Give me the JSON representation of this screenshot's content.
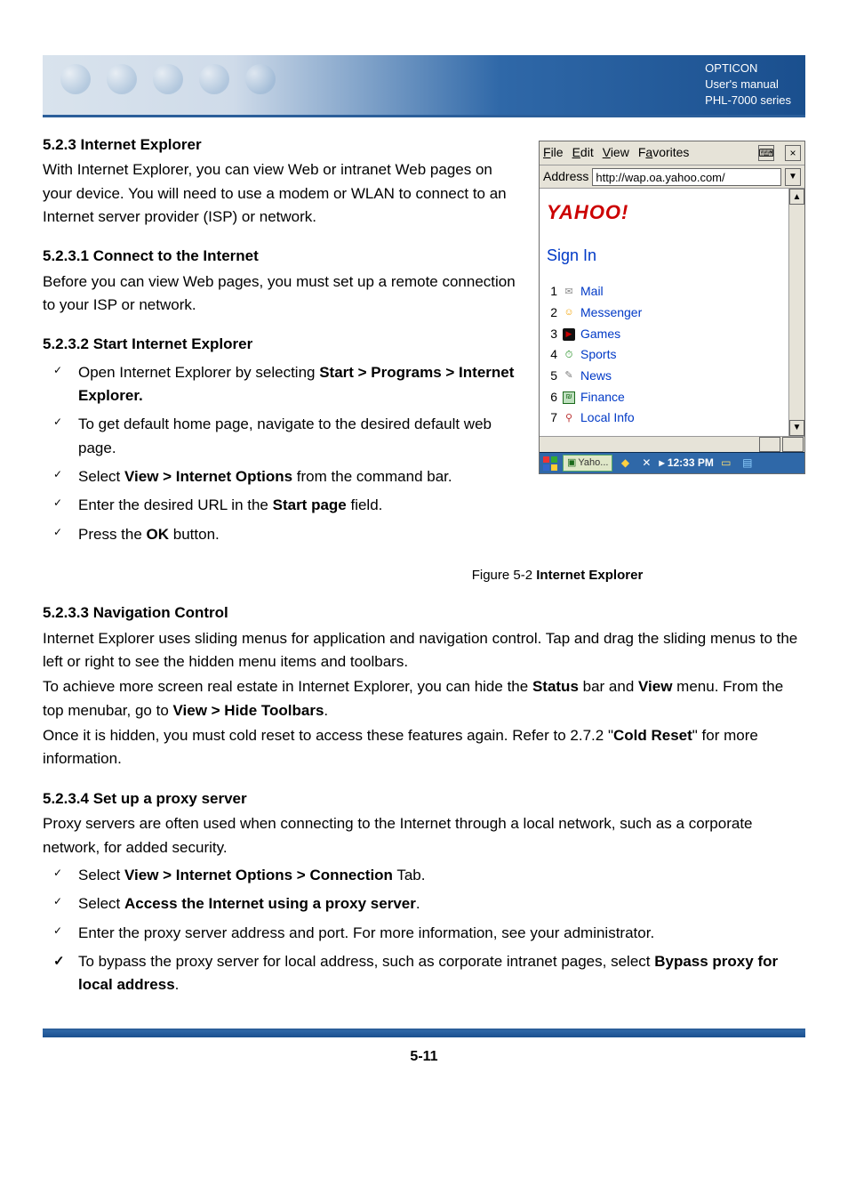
{
  "header": {
    "brand_line1": "OPTICON",
    "brand_line2": "User's manual",
    "brand_line3": "PHL-7000 series"
  },
  "sections": {
    "s523_title": "5.2.3 Internet Explorer",
    "s523_body": "With Internet Explorer, you can view Web or intranet Web pages on your device. You will need to use a modem or WLAN to connect to an Internet server provider (ISP) or network.",
    "s5231_title": "5.2.3.1 Connect to the Internet",
    "s5231_body": "Before you can view Web pages, you must set up a remote connection to your ISP or network.",
    "s5232_title": "5.2.3.2 Start Internet Explorer",
    "s5232_items": [
      {
        "prefix": "Open Internet Explorer by selecting ",
        "bold": "Start > Programs > Internet Explorer.",
        "suffix": ""
      },
      {
        "prefix": "To get default home page, navigate to the desired default web page.",
        "bold": "",
        "suffix": ""
      },
      {
        "prefix": "Select ",
        "bold": "View > Internet Options",
        "suffix": " from the command bar."
      },
      {
        "prefix": "Enter the desired URL in the ",
        "bold": "Start page",
        "suffix": " field."
      },
      {
        "prefix": "Press the ",
        "bold": "OK",
        "suffix": " button."
      }
    ],
    "figcap_prefix": "Figure 5-2 ",
    "figcap_bold": "Internet Explorer",
    "s5233_title": "5.2.3.3 Navigation Control",
    "s5233_p1": "Internet Explorer uses sliding menus for application and navigation control. Tap and drag the sliding menus to the left or right to see the hidden menu items and toolbars.",
    "s5233_p2a": "To achieve more screen real estate in Internet Explorer, you can hide the ",
    "s5233_p2_bold1": "Status",
    "s5233_p2b": " bar and ",
    "s5233_p2_bold2": "View",
    "s5233_p2c": " menu. From the top menubar, go to ",
    "s5233_p2_bold3": "View > Hide Toolbars",
    "s5233_p2d": ".",
    "s5233_p3a": "Once it is hidden, you must cold reset to access these features again. Refer to 2.7.2 \"",
    "s5233_p3_bold": "Cold Reset",
    "s5233_p3b": "\" for more information.",
    "s5234_title": "5.2.3.4 Set up a proxy server",
    "s5234_body": "Proxy servers are often used when connecting to the Internet through a local network, such as a corporate network, for added security.",
    "s5234_items": [
      {
        "prefix": "Select ",
        "bold": "View > Internet Options > Connection",
        "suffix": " Tab.",
        "bigcheck": false
      },
      {
        "prefix": "Select ",
        "bold": "Access the Internet using a proxy server",
        "suffix": ".",
        "bigcheck": false
      },
      {
        "prefix": "Enter the proxy server address and port. For more information, see your administrator.",
        "bold": "",
        "suffix": "",
        "bigcheck": false
      },
      {
        "prefix": "To bypass the proxy server for local address, such as corporate intranet pages, select ",
        "bold": "Bypass proxy for local address",
        "suffix": ".",
        "bigcheck": true
      }
    ]
  },
  "device": {
    "menus": {
      "file": "File",
      "edit": "Edit",
      "view": "View",
      "fav": "Favorites"
    },
    "keyboard_icon": "⌨",
    "close_icon": "×",
    "address_label": "Address",
    "address_value": "http://wap.oa.yahoo.com/",
    "logo": "YAHOO!",
    "signin": "Sign In",
    "links": [
      {
        "n": "1",
        "icon": "✉",
        "cls": "ic-mail",
        "label": "Mail"
      },
      {
        "n": "2",
        "icon": "☺",
        "cls": "ic-mess",
        "label": "Messenger"
      },
      {
        "n": "3",
        "icon": "▶",
        "cls": "ic-games",
        "label": "Games"
      },
      {
        "n": "4",
        "icon": "⏱",
        "cls": "ic-sports",
        "label": "Sports"
      },
      {
        "n": "5",
        "icon": "✎",
        "cls": "ic-news",
        "label": "News"
      },
      {
        "n": "6",
        "icon": "₪",
        "cls": "ic-fin",
        "label": "Finance"
      },
      {
        "n": "7",
        "icon": "⚲",
        "cls": "ic-local",
        "label": "Local Info"
      }
    ],
    "scroll_up": "▲",
    "scroll_down": "▼",
    "taskbar": {
      "tab_label": "Yaho...",
      "time_prefix": "▸ ",
      "time": "12:33 PM"
    }
  },
  "footer": {
    "page": "5-11"
  }
}
